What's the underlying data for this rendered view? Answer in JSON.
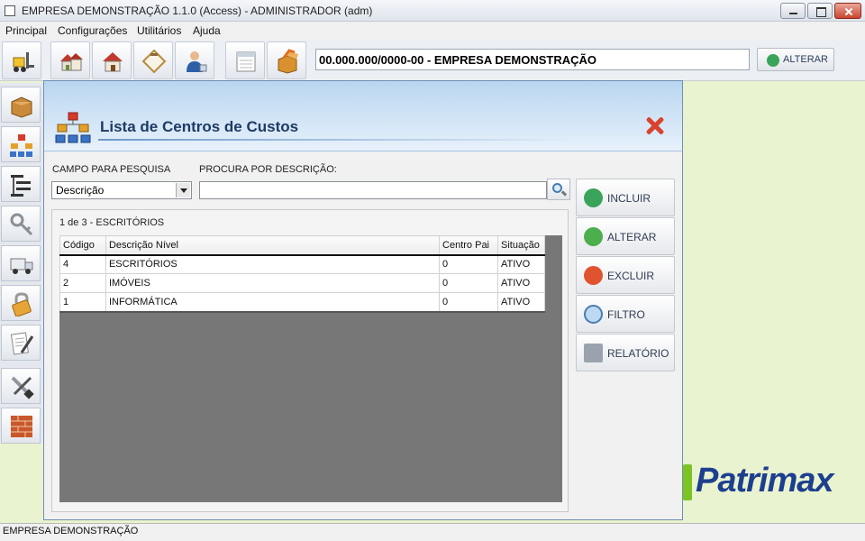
{
  "window": {
    "title": "EMPRESA DEMONSTRAÇÃO 1.1.0 (Access) - ADMINISTRADOR (adm)"
  },
  "menu": [
    "Principal",
    "Configurações",
    "Utilitários",
    "Ajuda"
  ],
  "toolbar": {
    "company_value": "00.000.000/0000-00 - EMPRESA DEMONSTRAÇÃO",
    "alterar_label": "ALTERAR"
  },
  "brand": {
    "logo_text": "Patrimax"
  },
  "dialog": {
    "title": "Lista de Centros de Custos",
    "campo_label": "CAMPO PARA PESQUISA",
    "campo_value": "Descrição",
    "procura_label": "PROCURA POR DESCRIÇÃO:",
    "procura_value": "",
    "record_info": "1 de 3 - ESCRITÓRIOS",
    "columns": [
      "Código",
      "Descrição Nível",
      "Centro Pai",
      "Situação"
    ],
    "rows": [
      [
        "4",
        "ESCRITÓRIOS",
        "0",
        "ATIVO"
      ],
      [
        "2",
        "IMÓVEIS",
        "0",
        "ATIVO"
      ],
      [
        "1",
        "INFORMÁTICA",
        "0",
        "ATIVO"
      ]
    ],
    "actions": {
      "incluir": "INCLUIR",
      "alterar": "ALTERAR",
      "excluir": "EXCLUIR",
      "filtro": "FILTRO",
      "relatorio": "RELATÓRIO"
    }
  },
  "status": {
    "text": "EMPRESA DEMONSTRAÇÃO"
  },
  "colors": {
    "accent": "#1e3b63",
    "brand_green": "#7cc424",
    "brand_blue": "#1d3f8f",
    "close_red": "#d8432f"
  }
}
